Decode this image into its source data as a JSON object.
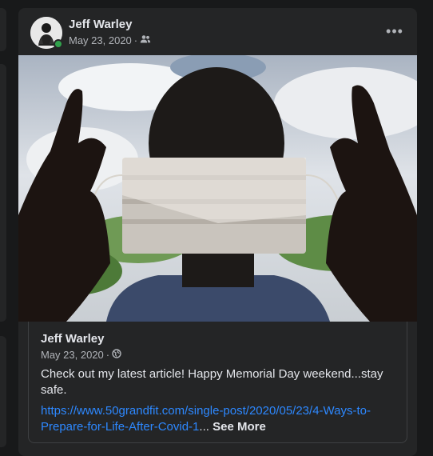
{
  "post": {
    "author": "Jeff Warley",
    "date": "May 23, 2020",
    "separator": "·",
    "audience_icon": "friends-icon",
    "more_label": "•••"
  },
  "shared_post": {
    "author": "Jeff Warley",
    "date": "May 23, 2020",
    "separator": "·",
    "audience_icon": "globe-icon",
    "text": "Check out my latest article! Happy Memorial Day weekend...stay safe.",
    "link_text": "https://www.50grandfit.com/single-post/2020/05/23/4-Ways-to-Prepare-for-Life-After-Covid-1",
    "ellipsis": "...",
    "see_more": "See More"
  },
  "colors": {
    "background": "#18191a",
    "card": "#242526",
    "link": "#2d88ff",
    "online": "#31a24c"
  }
}
